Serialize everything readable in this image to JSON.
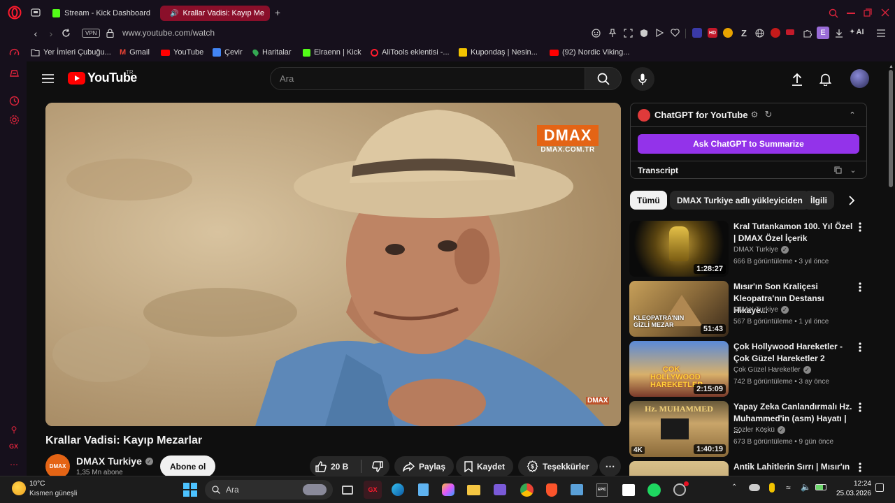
{
  "browser": {
    "tabs": [
      {
        "title": "Stream - Kick Dashboard",
        "active": false
      },
      {
        "title": "Krallar Vadisi: Kayıp Me",
        "active": true
      }
    ],
    "vpn_label": "VPN",
    "url": "www.youtube.com/watch",
    "ai_label": "AI",
    "ext_letter": "E",
    "left_sidebar_gx": "GX",
    "bookmarks": [
      {
        "label": "Yer İmleri Çubuğu...",
        "icon": "folder-icon"
      },
      {
        "label": "Gmail",
        "icon": "gmail-icon"
      },
      {
        "label": "YouTube",
        "icon": "youtube-icon"
      },
      {
        "label": "Çevir",
        "icon": "translate-icon"
      },
      {
        "label": "Haritalar",
        "icon": "maps-icon"
      },
      {
        "label": "Elraenn | Kick",
        "icon": "kick-icon"
      },
      {
        "label": "AliTools eklentisi -...",
        "icon": "opera-icon"
      },
      {
        "label": "Kupondaş | Nesin...",
        "icon": "kupondas-icon"
      },
      {
        "label": "(92) Nordic Viking...",
        "icon": "youtube-icon"
      }
    ]
  },
  "youtube": {
    "logo_text": "YouTube",
    "region": "TR",
    "search_placeholder": "Ara",
    "video": {
      "watermark_brand": "DMAX",
      "watermark_url": "DMAX.COM.TR",
      "corner_logo": "DMAX",
      "title": "Krallar Vadisi: Kayıp Mezarlar",
      "channel": "DMAX Turkiye",
      "subscribers": "1,35 Mn abone",
      "subscribe_label": "Abone ol",
      "likes": "20 B",
      "share_label": "Paylaş",
      "save_label": "Kaydet",
      "thanks_label": "Teşekkürler"
    },
    "chatgpt": {
      "title": "ChatGPT for YouTube",
      "summarize_label": "Ask ChatGPT to Summarize",
      "transcript_label": "Transcript"
    },
    "chips": [
      "Tümü",
      "DMAX Turkiye adlı yükleyiciden",
      "İlgili"
    ],
    "recommendations": [
      {
        "title": "Kral Tutankamon 100. Yıl Özel | DMAX Özel İçerik",
        "channel": "DMAX Turkiye",
        "meta": "666 B görüntüleme • 3 yıl önce",
        "duration": "1:28:27",
        "thumb_text": ""
      },
      {
        "title": "Mısır'ın Son Kraliçesi Kleopatra'nın Destansı Hikaye...",
        "channel": "DMAX Turkiye",
        "meta": "567 B görüntüleme • 1 yıl önce",
        "duration": "51:43",
        "thumb_text": "KLEOPATRA'NIN GİZLİ MEZAR"
      },
      {
        "title": "Çok Hollywood Hareketler - Çok Güzel Hareketler 2",
        "channel": "Çok Güzel Hareketler",
        "meta": "742 B görüntüleme • 3 ay önce",
        "duration": "2:15:09",
        "thumb_text": "ÇOK HOLLYWOOD HAREKETLER"
      },
      {
        "title": "Yapay Zeka Canlandırmalı Hz. Muhammed'in (asm) Hayatı | ...",
        "channel": "Sözler Köşkü",
        "meta": "673 B görüntüleme • 9 gün önce",
        "duration": "1:40:19",
        "thumb_text": "Hz. MUHAMMED",
        "badge": "4K"
      },
      {
        "title": "Antik Lahitlerin Sırrı | Mısır'ın",
        "channel": "",
        "meta": "",
        "duration": "",
        "thumb_text": ""
      }
    ]
  },
  "taskbar": {
    "weather_temp": "10°C",
    "weather_desc": "Kısmen güneşli",
    "search_placeholder": "Ara",
    "time": "12:24",
    "date": "25.03.2026"
  },
  "colors": {
    "opera_red": "#ff1b2d",
    "youtube_red": "#ff0000",
    "chatgpt_purple": "#9333ea",
    "active_tab": "#8a0f2a"
  }
}
